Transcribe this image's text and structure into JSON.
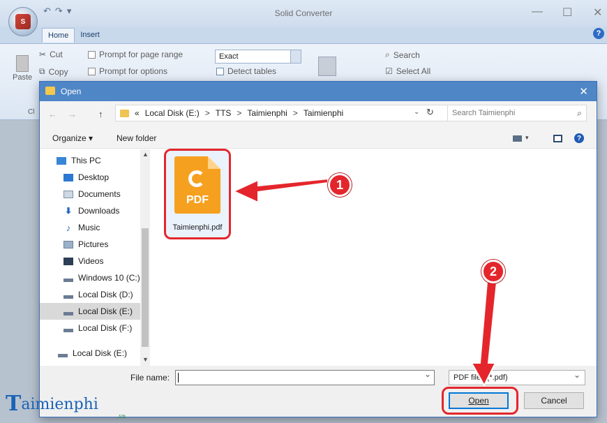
{
  "app": {
    "title": "Solid Converter",
    "qat": [
      "↶",
      "↷",
      "▾"
    ],
    "tabs": [
      "Home",
      "Insert"
    ],
    "help": "?",
    "ribbon": {
      "paste_label": "Paste",
      "cut_label": "Cut",
      "copy_label": "Copy",
      "clipboard_group": "Cl",
      "prompt_page_range": "Prompt for page range",
      "prompt_options": "Prompt for options",
      "mode_value": "Exact",
      "detect_tables": "Detect tables",
      "search_label": "Search",
      "select_all_label": "Select All"
    },
    "window_controls": {
      "minimize": "—",
      "maximize": "☐",
      "close": "✕"
    }
  },
  "dialog": {
    "title": "Open",
    "close": "✕",
    "nav": {
      "back": "←",
      "forward": "→",
      "up": "↑"
    },
    "address": {
      "prefix": "«",
      "crumbs": [
        "Local Disk (E:)",
        "TTS",
        "Taimienphi",
        "Taimienphi"
      ],
      "separator": ">"
    },
    "search_placeholder": "Search Taimienphi",
    "toolbar": {
      "organize": "Organize ▾",
      "new_folder": "New folder"
    },
    "nav_pane": [
      {
        "label": "This PC",
        "icon": "monitor-icon"
      },
      {
        "label": "Desktop",
        "icon": "desktop-icon"
      },
      {
        "label": "Documents",
        "icon": "documents-icon"
      },
      {
        "label": "Downloads",
        "icon": "downloads-icon"
      },
      {
        "label": "Music",
        "icon": "music-icon"
      },
      {
        "label": "Pictures",
        "icon": "pictures-icon"
      },
      {
        "label": "Videos",
        "icon": "videos-icon"
      },
      {
        "label": "Windows 10 (C:)",
        "icon": "drive-icon"
      },
      {
        "label": "Local Disk (D:)",
        "icon": "drive-icon"
      },
      {
        "label": "Local Disk (E:)",
        "icon": "drive-icon",
        "selected": true
      },
      {
        "label": "Local Disk (F:)",
        "icon": "drive-icon"
      },
      {
        "label": "Local Disk (E:)",
        "icon": "drive-icon"
      }
    ],
    "files": [
      {
        "name": "Taimienphi.pdf",
        "type_label": "PDF"
      }
    ],
    "file_name_label": "File name:",
    "file_name_value": "",
    "file_type": "PDF files (*.pdf)",
    "open_button": "Open",
    "cancel_button": "Cancel"
  },
  "annotations": {
    "step1": "1",
    "step2": "2",
    "color": "#e4262c"
  },
  "watermark": {
    "first_letter": "T",
    "rest": "aimienphi",
    "tld": ".vn"
  }
}
